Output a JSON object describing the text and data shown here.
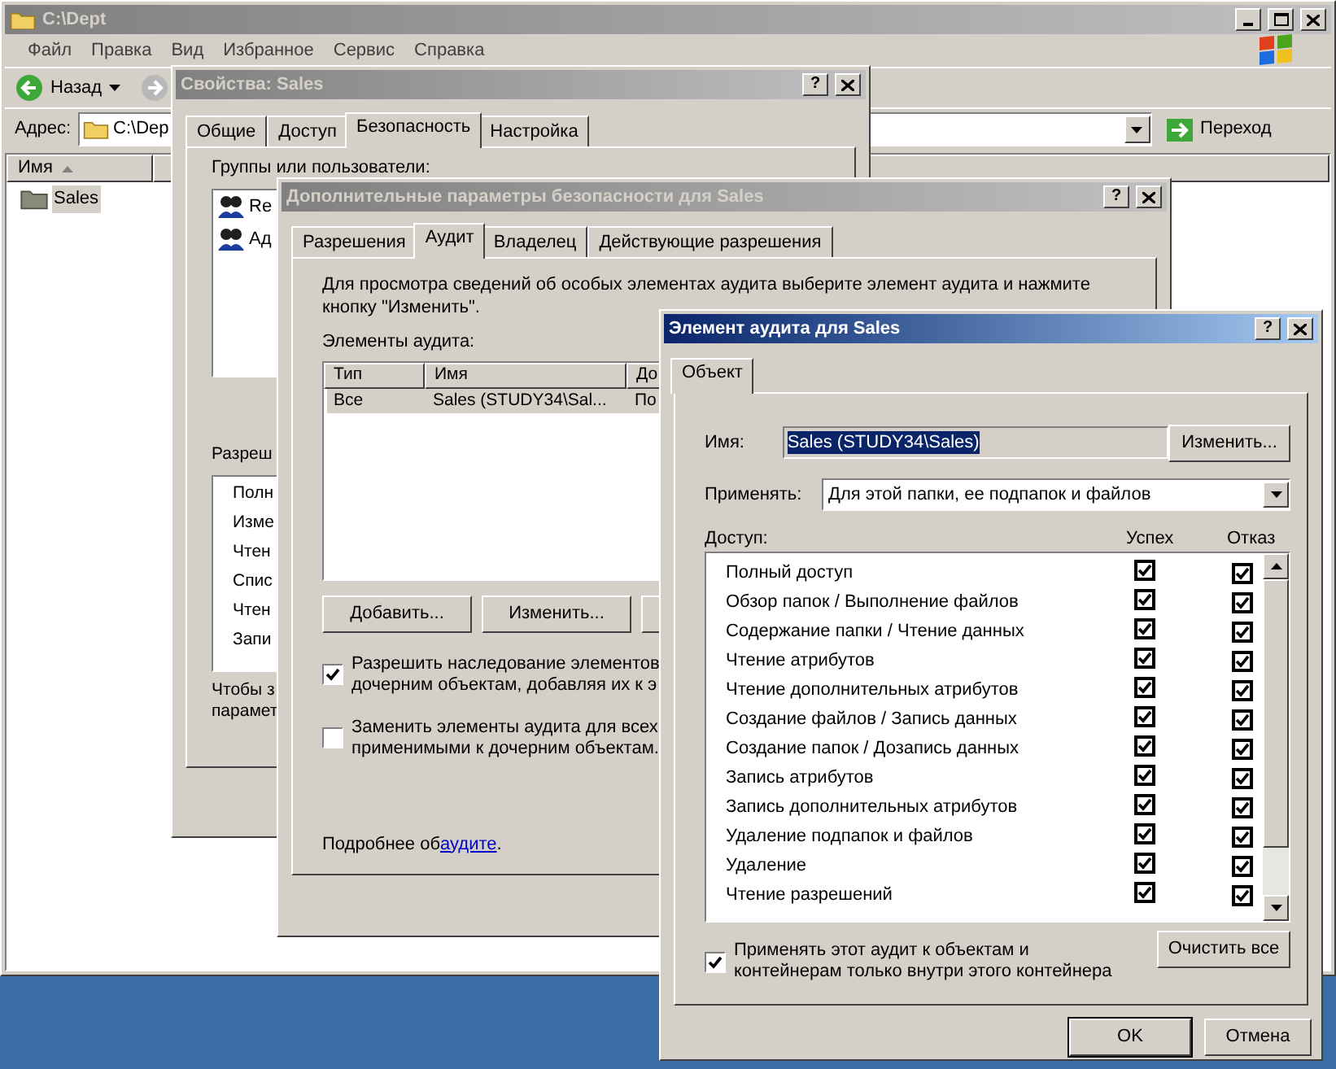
{
  "explorer": {
    "title": "C:\\Dept",
    "active": false,
    "menu": [
      "Файл",
      "Правка",
      "Вид",
      "Избранное",
      "Сервис",
      "Справка"
    ],
    "back": "Назад",
    "address_label": "Адрес:",
    "address": "C:\\Dep",
    "go": "Переход",
    "columns": [
      "Имя"
    ],
    "items": [
      {
        "name": "Sales",
        "selected": true
      }
    ]
  },
  "properties": {
    "title": "Свойства: Sales",
    "active": false,
    "help": "?",
    "tabs": [
      {
        "label": "Общие",
        "selected": false
      },
      {
        "label": "Доступ",
        "selected": false
      },
      {
        "label": "Безопасность",
        "selected": true
      },
      {
        "label": "Настройка",
        "selected": false
      }
    ],
    "groups_label": "Группы или пользователи:",
    "groups": [
      "Re",
      "Ад"
    ],
    "permissions_label": "Разреш",
    "permissions": [
      "Полн",
      "Изме",
      "Чтен",
      "Спис",
      "Чтен",
      "Запи"
    ],
    "note": [
      "Чтобы з",
      "парамет"
    ]
  },
  "advanced": {
    "title": "Дополнительные параметры безопасности для Sales",
    "active": false,
    "help": "?",
    "tabs": [
      {
        "label": "Разрешения",
        "selected": false
      },
      {
        "label": "Аудит",
        "selected": true
      },
      {
        "label": "Владелец",
        "selected": false
      },
      {
        "label": "Действующие разрешения",
        "selected": false
      }
    ],
    "intro": [
      "Для просмотра сведений об особых элементах аудита выберите элемент аудита и нажмите",
      "кнопку \"Изменить\"."
    ],
    "entries_label": "Элементы аудита:",
    "columns": [
      "Тип",
      "Имя",
      "До"
    ],
    "rows": [
      {
        "cells": [
          "Все",
          "Sales (STUDY34\\Sal...",
          "По"
        ],
        "selected": true
      }
    ],
    "buttons": [
      "Добавить...",
      "Изменить..."
    ],
    "options": [
      {
        "lines": [
          "Разрешить наследование элементов",
          "дочерним объектам, добавляя их к э"
        ],
        "checked": true
      },
      {
        "lines": [
          "Заменить элементы аудита для всех",
          "применимыми к дочерним объектам."
        ],
        "checked": false
      }
    ],
    "more_text": "Подробнее об ",
    "more_link": "аудите",
    "more_end": "."
  },
  "audit_entry": {
    "title": "Элемент аудита для Sales",
    "active": true,
    "help": "?",
    "tabs": [
      {
        "label": "Объект",
        "selected": true
      }
    ],
    "name_label": "Имя:",
    "name_value": "Sales (STUDY34\\Sales)",
    "change": "Изменить...",
    "apply_label": "Применять:",
    "apply_value": "Для этой папки, ее подпапок и файлов",
    "access_label": "Доступ:",
    "success_label": "Успех",
    "failure_label": "Отказ",
    "rows": [
      {
        "label": "Полный доступ",
        "success": true,
        "failure": true
      },
      {
        "label": "Обзор папок / Выполнение файлов",
        "success": true,
        "failure": true
      },
      {
        "label": "Содержание папки / Чтение данных",
        "success": true,
        "failure": true
      },
      {
        "label": "Чтение атрибутов",
        "success": true,
        "failure": true
      },
      {
        "label": "Чтение дополнительных атрибутов",
        "success": true,
        "failure": true
      },
      {
        "label": "Создание файлов / Запись данных",
        "success": true,
        "failure": true
      },
      {
        "label": "Создание папок / Дозапись данных",
        "success": true,
        "failure": true
      },
      {
        "label": "Запись атрибутов",
        "success": true,
        "failure": true
      },
      {
        "label": "Запись дополнительных атрибутов",
        "success": true,
        "failure": true
      },
      {
        "label": "Удаление подпапок и файлов",
        "success": true,
        "failure": true
      },
      {
        "label": "Удаление",
        "success": true,
        "failure": true
      },
      {
        "label": "Чтение разрешений",
        "success": true,
        "failure": true
      }
    ],
    "container_only": {
      "lines": [
        "Применять этот аудит к объектам и",
        "контейнерам только внутри этого контейнера"
      ],
      "checked": true
    },
    "clear": "Очистить все",
    "ok": "OK",
    "cancel": "Отмена"
  }
}
